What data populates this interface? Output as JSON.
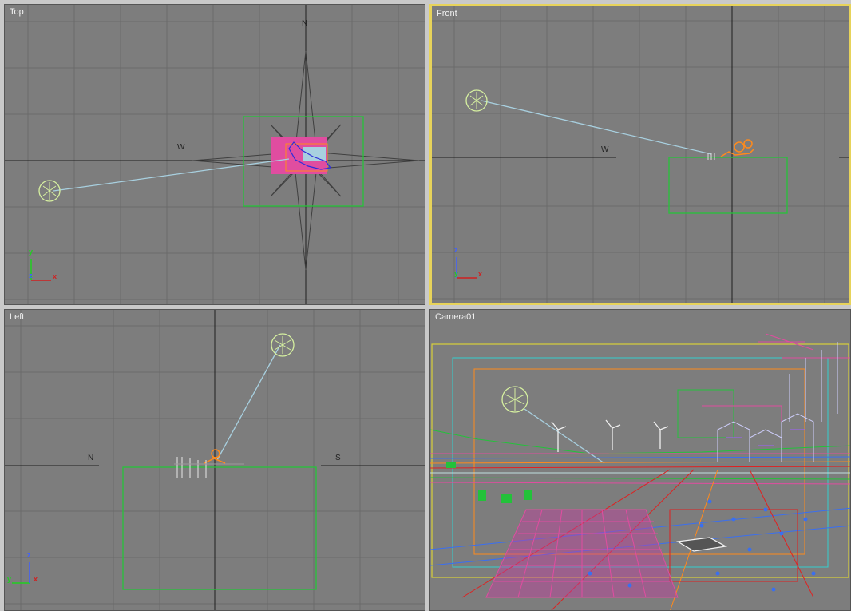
{
  "viewports": {
    "top": {
      "label": "Top",
      "compass": {
        "west": "W",
        "north": "N"
      }
    },
    "front": {
      "label": "Front",
      "compass": {
        "west": "W"
      }
    },
    "left": {
      "label": "Left",
      "compass": {
        "north": "N",
        "south": "S"
      }
    },
    "camera": {
      "label": "Camera01"
    }
  },
  "axis_gizmo": {
    "x": "x",
    "y": "y",
    "z": "z"
  },
  "colors": {
    "viewport_bg": "#7d7d7d",
    "grid": "#6b6b6b",
    "active_border": "#e7d35a",
    "light_target_line": "#a8d0e0",
    "light_icon": "#d6f0a0",
    "selection_box": "#27c43a",
    "floor_magenta": "#e04da0",
    "camera_orange": "#ff8a1c"
  }
}
